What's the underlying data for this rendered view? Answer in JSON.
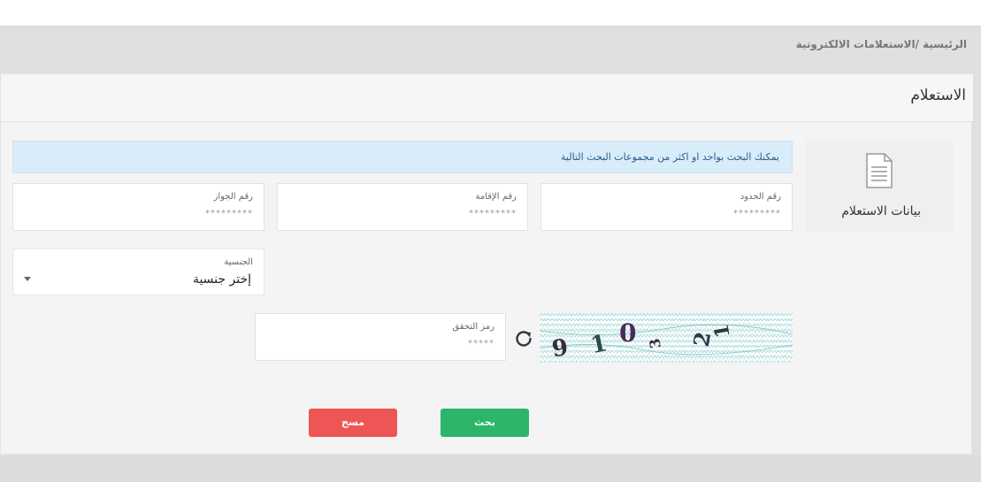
{
  "breadcrumb": "الرئيسية /الاستعلامات الالكترونية",
  "card": {
    "title": "الاستعلام"
  },
  "side_tab": {
    "label": "بيانات الاستعلام",
    "icon": "document-icon"
  },
  "info": {
    "text": "يمكنك البحث بواحد او اكثر من مجموعات البحث التالية"
  },
  "fields": {
    "border_number": {
      "label": "رقم الحدود",
      "placeholder": "*********"
    },
    "iqama_number": {
      "label": "رقم الإقامة",
      "placeholder": "*********"
    },
    "passport_number": {
      "label": "رقم الجواز",
      "placeholder": "*********"
    },
    "nationality": {
      "label": "الجنسية",
      "selected": "إختر جنسية"
    },
    "captcha_code": {
      "label": "رمز التحقق",
      "placeholder": "*****"
    }
  },
  "captcha": {
    "text": "910321"
  },
  "buttons": {
    "search": "بحث",
    "clear": "مسح"
  },
  "colors": {
    "search": "#2db56a",
    "clear": "#ee5555",
    "info_bg": "#d9ecfa"
  }
}
